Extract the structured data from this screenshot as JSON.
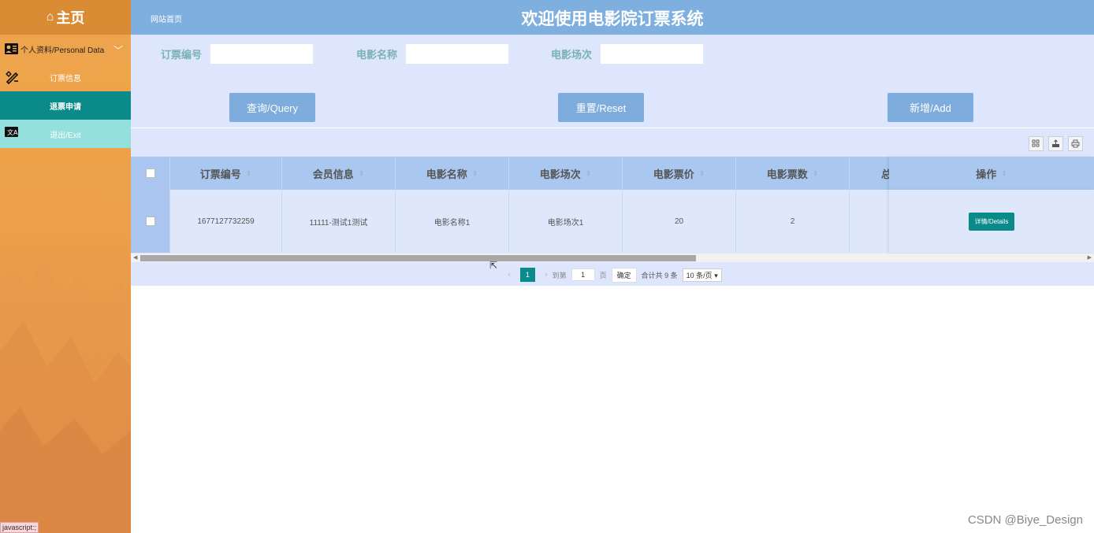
{
  "sidebar": {
    "home": "主页",
    "group": "个人资料/Personal Data",
    "items": [
      {
        "label": "订票信息"
      },
      {
        "label": "退票申请"
      },
      {
        "label": "退出/Exit"
      }
    ],
    "status_tip": "javascript:;"
  },
  "header": {
    "breadcrumb": "网站首页",
    "title": "欢迎使用电影院订票系统"
  },
  "search": {
    "fields": [
      {
        "label": "订票编号",
        "value": ""
      },
      {
        "label": "电影名称",
        "value": ""
      },
      {
        "label": "电影场次",
        "value": ""
      }
    ],
    "query": "查询/Query",
    "reset": "重置/Reset",
    "add": "新增/Add"
  },
  "table": {
    "columns": [
      "订票编号",
      "会员信息",
      "电影名称",
      "电影场次",
      "电影票价",
      "电影票数",
      "总"
    ],
    "op_header": "操作",
    "rows": [
      [
        "1677127732259",
        "11111-测试1测试",
        "电影名称1",
        "电影场次1",
        "20",
        "2",
        ""
      ]
    ],
    "detail_btn": "详情/Details"
  },
  "pager": {
    "current": "1",
    "goto": "到第",
    "page_input": "1",
    "page_unit": "页",
    "confirm": "确定",
    "total": "合计共 9 条",
    "page_size": "10 条/页"
  },
  "watermark": "CSDN @Biye_Design",
  "colors": {
    "teal": "#0b8a8a",
    "header": "#7eafdf",
    "panel": "#dde6fd",
    "sidebar": "#eca14a"
  }
}
